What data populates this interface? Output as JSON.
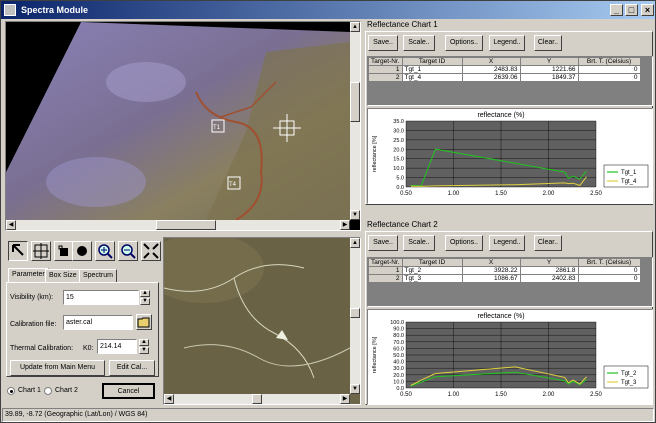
{
  "window": {
    "title": "Spectra Module"
  },
  "toolbar_icons": [
    "arrow-icon",
    "crosshair-icon",
    "pan-icon",
    "target-icon",
    "zoom-in-icon",
    "zoom-out-icon",
    "zoom-fit-icon"
  ],
  "tabs": [
    "Parameter",
    "Box Size",
    "Spectrum"
  ],
  "params": {
    "visibility_label": "Visibility (km):",
    "visibility_value": "15",
    "calibration_label": "Calibration file:",
    "calibration_value": "aster.cal",
    "thermal_label": "Thermal Calibration:",
    "k0_label": "K0:",
    "k0_value": "214.14",
    "update_button": "Update from Main Menu",
    "edit_button": "Edit Cal...",
    "radio_chart1": "Chart 1",
    "radio_chart2": "Chart 2",
    "cancel_button": "Cancel"
  },
  "chart1_panel": {
    "title": "Reflectance Chart 1",
    "buttons": [
      "Save..",
      "Scale..",
      "Options..",
      "Legend..",
      "Clear.."
    ],
    "columns": [
      "Target-Nr.",
      "Target ID",
      "X",
      "Y",
      "Brt. T. (Celsius)"
    ],
    "rows": [
      [
        "1",
        "Tgt_1",
        "2483.83",
        "1221.66",
        "0"
      ],
      [
        "2",
        "Tgt_4",
        "2639.06",
        "1849.37",
        "0"
      ]
    ]
  },
  "chart2_panel": {
    "title": "Reflectance Chart 2",
    "buttons": [
      "Save..",
      "Scale..",
      "Options..",
      "Legend..",
      "Clear.."
    ],
    "columns": [
      "Target-Nr.",
      "Target ID",
      "X",
      "Y",
      "Brt. T. (Celsius)"
    ],
    "rows": [
      [
        "1",
        "Tgt_2",
        "3928.22",
        "2861.8",
        "0"
      ],
      [
        "2",
        "Tgt_3",
        "1086.67",
        "2402.83",
        "0"
      ]
    ]
  },
  "map_markers": [
    "T1",
    "T4"
  ],
  "status": {
    "text": "39.89, -8.72  (Geographic (Lat/Lon) / WGS 84)"
  },
  "colors": {
    "series_green": "#22c322",
    "series_yellow": "#e0d040",
    "plot_bg": "#606060"
  },
  "chart_data": [
    {
      "type": "line",
      "title": "reflectance (%)",
      "ylabel": "reflectance [%]",
      "xlabel": "",
      "xlim": [
        0.5,
        2.5
      ],
      "ylim": [
        0,
        35
      ],
      "xticks": [
        "0.50",
        "1.00",
        "1.50",
        "2.00",
        "2.50"
      ],
      "yticks": [
        "0.0",
        "5.0",
        "10.0",
        "15.0",
        "20.0",
        "25.0",
        "30.0",
        "35.0"
      ],
      "legend": "bottom-right",
      "series": [
        {
          "name": "Tgt_1",
          "x": [
            0.55,
            0.66,
            0.81,
            2.17,
            2.21,
            2.26,
            2.33,
            2.4
          ],
          "y": [
            0.8,
            0.7,
            20.1,
            7.9,
            4.6,
            5.8,
            4.1,
            8.5
          ]
        },
        {
          "name": "Tgt_4",
          "x": [
            0.55,
            0.66,
            0.81,
            1.65,
            2.17,
            2.21,
            2.26,
            2.33,
            2.4
          ],
          "y": [
            0.4,
            0.3,
            0.6,
            1.2,
            2.2,
            1.8,
            2.0,
            0.8,
            5.4
          ]
        }
      ]
    },
    {
      "type": "line",
      "title": "reflectance (%)",
      "ylabel": "reflectance [%]",
      "xlabel": "",
      "xlim": [
        0.5,
        2.5
      ],
      "ylim": [
        0,
        100
      ],
      "xticks": [
        "0.50",
        "1.00",
        "1.50",
        "2.00",
        "2.50"
      ],
      "yticks": [
        "0.0",
        "10.0",
        "20.0",
        "30.0",
        "40.0",
        "50.0",
        "60.0",
        "70.0",
        "80.0",
        "90.0",
        "100.0"
      ],
      "legend": "bottom-right",
      "series": [
        {
          "name": "Tgt_2",
          "x": [
            0.55,
            0.66,
            0.81,
            1.65,
            2.17,
            2.21,
            2.26,
            2.33,
            2.4
          ],
          "y": [
            3,
            9,
            17,
            24,
            11,
            6,
            10,
            5,
            13
          ]
        },
        {
          "name": "Tgt_3",
          "x": [
            0.55,
            0.66,
            0.81,
            1.65,
            2.17,
            2.21,
            2.26,
            2.33,
            2.4
          ],
          "y": [
            4,
            12,
            22,
            32,
            16,
            8,
            12,
            6,
            17
          ]
        }
      ]
    }
  ]
}
